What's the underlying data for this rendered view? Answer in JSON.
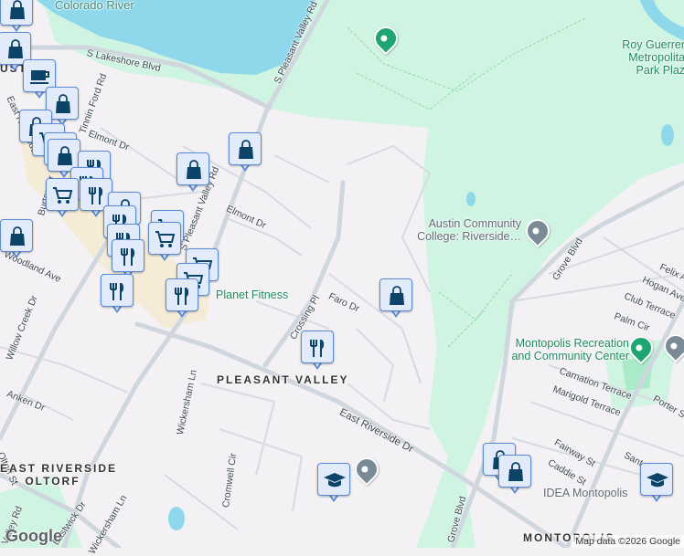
{
  "map": {
    "water_labels": [
      "Colorado River"
    ],
    "roads": {
      "lakeshore": "S Lakeshore Blvd",
      "pleasant_valley_n": "S Pleasant Valley Rd",
      "pleasant_valley_s": "S Pleasant Valley Rd",
      "elmont_1": "Elmont Dr",
      "elmont_2": "Elmont Dr",
      "tinnin": "Tinnin Ford Rd",
      "east_riverside": "East Riverside Dr",
      "willow_creek": "Willow Creek Dr",
      "anken": "Anken Dr",
      "wickersham": "Wickersham Ln",
      "wickersham_s": "Wickersham Ln",
      "cromwell": "Cromwell Cir",
      "crossing": "Crossing Pl",
      "faro": "Faro Dr",
      "grove_n": "Grove Blvd",
      "grove_s": "Grove Blvd",
      "felix": "Felix Ave",
      "hogan": "Hogan Ave",
      "club": "Club Terrace",
      "palm": "Palm Cir",
      "carnation": "Carnation Terrace",
      "marigold": "Marigold Terrace",
      "porter": "Porter St",
      "fairway": "Fairway St",
      "caddie": "Caddie St",
      "santos": "Santos St",
      "oltorf": "Oltorf St",
      "valley": "Valley Rd",
      "eastwick": "Eastwick Dr",
      "burton": "Burton Dr",
      "woodland": "Woodland Ave",
      "east_r": "East Riverside"
    },
    "areas": {
      "pleasant_valley": "PLEASANT VALLEY",
      "east_riverside_oltorf_1": "EAST RIVERSIDE",
      "east_riverside_oltorf_2": "- OLTORF",
      "montopolis": "MONTOPOLIS",
      "ustd": "USTD"
    },
    "pois": {
      "roy_guerrero": "Roy Guerrero Metropolitan Park Plaza",
      "acc": "Austin Community College: Riverside…",
      "planet_fitness": "Planet Fitness",
      "montopolis_rec": "Montopolis Recreation and Community Center",
      "idea": "IDEA Montopolis"
    },
    "colors": {
      "water": "#8fd8ec",
      "park": "#cff5e2",
      "marker_border": "#5a8ad8",
      "icon": "#0b4468",
      "poi_green": "#1e8a5c"
    },
    "attribution": "Map data ©2026 Google",
    "logo": "Google"
  }
}
